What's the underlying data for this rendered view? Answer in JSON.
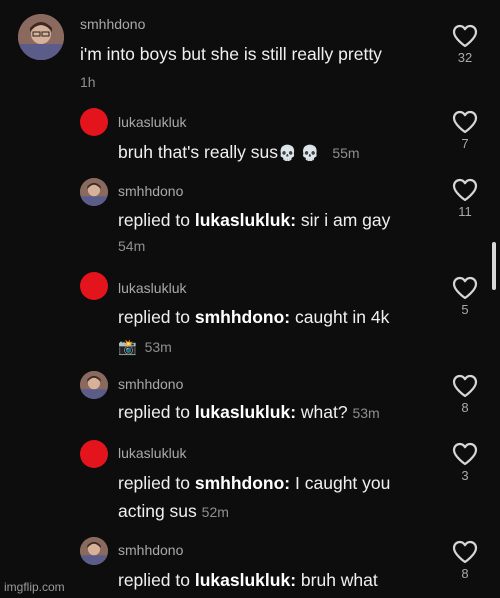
{
  "comments": [
    {
      "username": "smhhdono",
      "text": "i'm into boys but she is still really pretty",
      "time": "1h",
      "likes": "32",
      "avatar": "photo-avatar"
    },
    {
      "username": "lukaslukluk",
      "text": "bruh that's really sus",
      "emojis": "💀 💀",
      "time": "55m",
      "likes": "7",
      "avatar": "red-circle-avatar"
    },
    {
      "username": "smhhdono",
      "prefix": "replied to",
      "mention": "lukaslukluk:",
      "text": "sir i am gay",
      "time": "54m",
      "likes": "11",
      "avatar": "photo-avatar"
    },
    {
      "username": "lukaslukluk",
      "prefix": "replied to",
      "mention": "smhhdono:",
      "text": "caught in 4k",
      "emoji": "📸",
      "time": "53m",
      "likes": "5",
      "avatar": "red-circle-avatar"
    },
    {
      "username": "smhhdono",
      "prefix": "replied to",
      "mention": "lukaslukluk:",
      "text": "what?",
      "time": "53m",
      "likes": "8",
      "avatar": "photo-avatar"
    },
    {
      "username": "lukaslukluk",
      "prefix": "replied to",
      "mention": "smhhdono:",
      "text": "I caught you",
      "text2": "acting sus",
      "time": "52m",
      "likes": "3",
      "avatar": "red-circle-avatar"
    },
    {
      "username": "smhhdono",
      "prefix": "replied to",
      "mention": "lukaslukluk:",
      "text": "bruh what",
      "likes": "8",
      "avatar": "photo-avatar"
    }
  ],
  "watermark": "imgflip.com",
  "colors": {
    "background": "#0d0d0d",
    "red_avatar": "#e3141c",
    "username": "#a9a9a9",
    "text": "#f0f0f0"
  }
}
